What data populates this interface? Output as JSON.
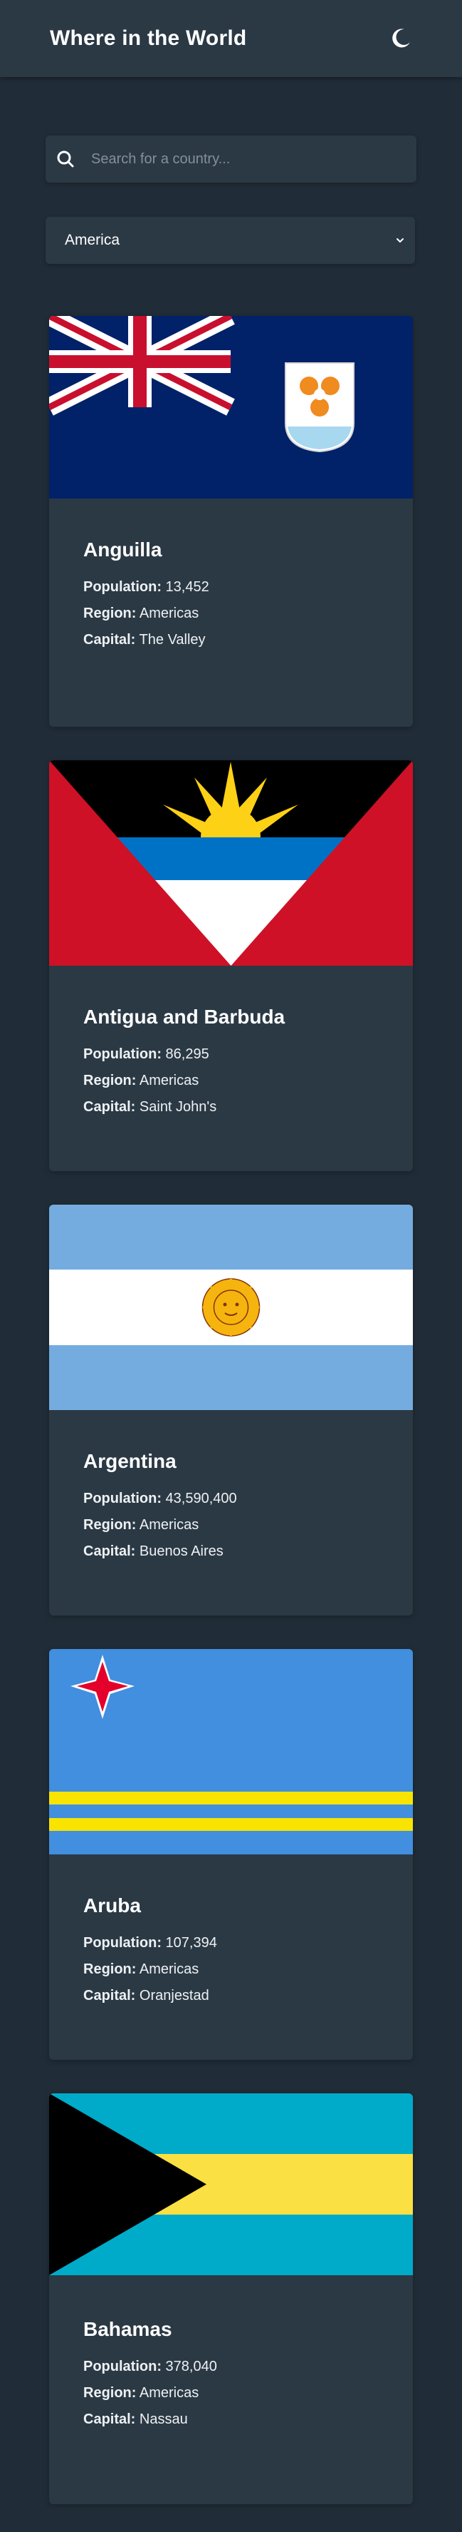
{
  "header": {
    "title": "Where in the World",
    "theme_icon": "moon-icon"
  },
  "search": {
    "placeholder": "Search for a country...",
    "value": ""
  },
  "filter": {
    "selected": "America"
  },
  "labels": {
    "population": "Population:",
    "region": "Region:",
    "capital": "Capital:"
  },
  "countries": [
    {
      "name": "Anguilla",
      "population": "13,452",
      "region": "Americas",
      "capital": "The Valley"
    },
    {
      "name": "Antigua and Barbuda",
      "population": "86,295",
      "region": "Americas",
      "capital": "Saint John's"
    },
    {
      "name": "Argentina",
      "population": "43,590,400",
      "region": "Americas",
      "capital": "Buenos Aires"
    },
    {
      "name": "Aruba",
      "population": "107,394",
      "region": "Americas",
      "capital": "Oranjestad"
    },
    {
      "name": "Bahamas",
      "population": "378,040",
      "region": "Americas",
      "capital": "Nassau"
    }
  ],
  "colors": {
    "background": "#202c37",
    "element": "#2b3945",
    "text": "#ffffff",
    "placeholder": "#858f98"
  }
}
